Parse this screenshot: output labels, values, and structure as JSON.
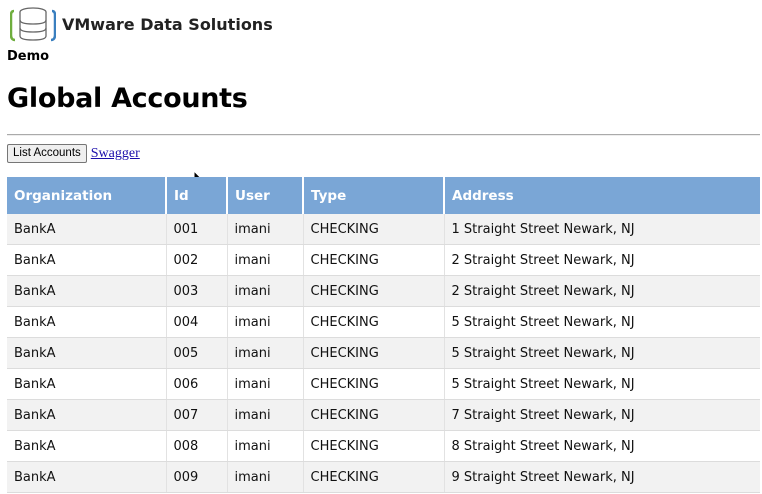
{
  "header": {
    "brand_name": "VMware Data Solutions",
    "subtitle": "Demo",
    "page_title": "Global Accounts"
  },
  "toolbar": {
    "list_accounts_label": "List Accounts",
    "swagger_label": "Swagger"
  },
  "table": {
    "columns": [
      "Organization",
      "Id",
      "User",
      "Type",
      "Address"
    ],
    "rows": [
      [
        "BankA",
        "001",
        "imani",
        "CHECKING",
        "1 Straight Street Newark, NJ"
      ],
      [
        "BankA",
        "002",
        "imani",
        "CHECKING",
        "2 Straight Street Newark, NJ"
      ],
      [
        "BankA",
        "003",
        "imani",
        "CHECKING",
        "2 Straight Street Newark, NJ"
      ],
      [
        "BankA",
        "004",
        "imani",
        "CHECKING",
        "5 Straight Street Newark, NJ"
      ],
      [
        "BankA",
        "005",
        "imani",
        "CHECKING",
        "5 Straight Street Newark, NJ"
      ],
      [
        "BankA",
        "006",
        "imani",
        "CHECKING",
        "5 Straight Street Newark, NJ"
      ],
      [
        "BankA",
        "007",
        "imani",
        "CHECKING",
        "7 Straight Street Newark, NJ"
      ],
      [
        "BankA",
        "008",
        "imani",
        "CHECKING",
        "8 Straight Street Newark, NJ"
      ],
      [
        "BankA",
        "009",
        "imani",
        "CHECKING",
        "9 Straight Street Newark, NJ"
      ]
    ]
  },
  "colors": {
    "header_bg": "#7aa6d6",
    "row_alt_bg": "#f2f2f2",
    "link": "#1a0dab"
  },
  "icons": {
    "logo": "database-logo-icon",
    "cursor": "mouse-pointer-icon"
  }
}
